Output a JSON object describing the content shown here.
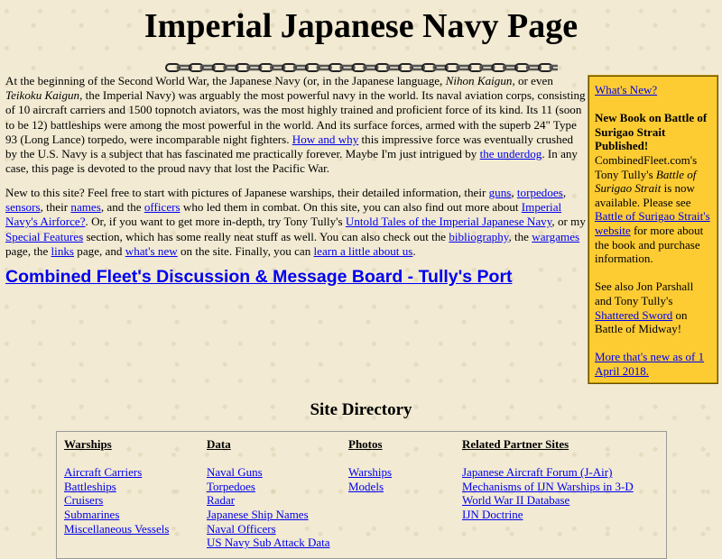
{
  "page": {
    "title": "Imperial Japanese Navy Page"
  },
  "intro": {
    "t1": "At the beginning of the Second World War, the Japanese Navy (or, in the Japanese language, ",
    "nihon_kaigun": "Nihon Kaigun",
    "t2": ", or even ",
    "teikoku_kaigun": "Teikoku Kaigun",
    "t3": ", the Imperial Navy) was arguably the most powerful navy in the world. Its naval aviation corps, consisting of 10 aircraft carriers and 1500 topnotch aviators, was the most highly trained and proficient force of its kind. Its 11 (soon to be 12) battleships were among the most powerful in the world. And its surface forces, armed with the superb 24\" Type 93 (Long Lance) torpedo, were incomparable night fighters. ",
    "link_how_why": "How and why",
    "t4": " this impressive force was eventually crushed by the U.S. Navy is a subject that has fascinated me practically forever. Maybe I'm just intrigued by ",
    "link_underdog": "the underdog",
    "t5": ". In any case, this page is devoted to the proud navy that lost the Pacific War."
  },
  "newto": {
    "t1": "New to this site? Feel free to start with pictures of Japanese warships, their detailed information, their ",
    "link_guns": "guns",
    "s1": ", ",
    "link_torpedoes": "torpedoes",
    "s2": ", ",
    "link_sensors": "sensors",
    "t2": ", their ",
    "link_names": "names",
    "t3": ", and the ",
    "link_officers": "officers",
    "t4": " who led them in combat. On this site, you can also find out more about ",
    "link_airforce": "Imperial Navy's Airforce?",
    "t5": ". Or, if you want to get more in-depth, try Tony Tully's ",
    "link_untold": "Untold Tales of the Imperial Japanese Navy",
    "t6": ", or my ",
    "link_special": "Special Features",
    "t7": " section, which has some really neat stuff as well. You can also check out the ",
    "link_biblio": "bibliography",
    "t8": ", the ",
    "link_wargames": "wargames",
    "t9": " page, the ",
    "link_links": "links",
    "t10": " page, and ",
    "link_whatsnew": "what's new",
    "t11": " on the site. Finally, you can ",
    "link_learn": "learn a little about us",
    "t12": "."
  },
  "board": {
    "label": "Combined Fleet's Discussion & Message Board - Tully's Port"
  },
  "whatsnew": {
    "heading": "What's New?",
    "book_heading": "New Book on Battle of Surigao Strait Published!",
    "p1_a": "CombinedFleet.com's Tony Tully's ",
    "p1_book": "Battle of Surigao Strait",
    "p1_b": " is now available. Please see ",
    "p1_link": "Battle of Surigao Strait's website",
    "p1_c": " for more about the book and purchase information.",
    "p2_a": "See also Jon Parshall and Tony Tully's ",
    "p2_link": "Shattered Sword",
    "p2_b": " on Battle of Midway!",
    "more_link": "More that's new as of 1 April 2018."
  },
  "directory": {
    "title": "Site Directory",
    "columns": [
      {
        "heading": "Warships",
        "items": [
          "Aircraft Carriers",
          "Battleships",
          "Cruisers",
          "Submarines",
          "Miscellaneous Vessels"
        ]
      },
      {
        "heading": "Data",
        "items": [
          "Naval Guns",
          "Torpedoes",
          "Radar",
          "Japanese Ship Names",
          "Naval Officers",
          "US Navy Sub Attack Data"
        ]
      },
      {
        "heading": "Photos",
        "items": [
          "Warships",
          "Models"
        ]
      },
      {
        "heading": "Related Partner Sites",
        "items": [
          "Japanese Aircraft Forum (J-Air)",
          "Mechanisms of IJN Warships in 3-D",
          "World War II Database",
          "IJN Doctrine"
        ]
      }
    ]
  },
  "colors": {
    "background": "#f2ead2",
    "link": "#0000ee",
    "whatsnew_box": "#fdcc33"
  }
}
